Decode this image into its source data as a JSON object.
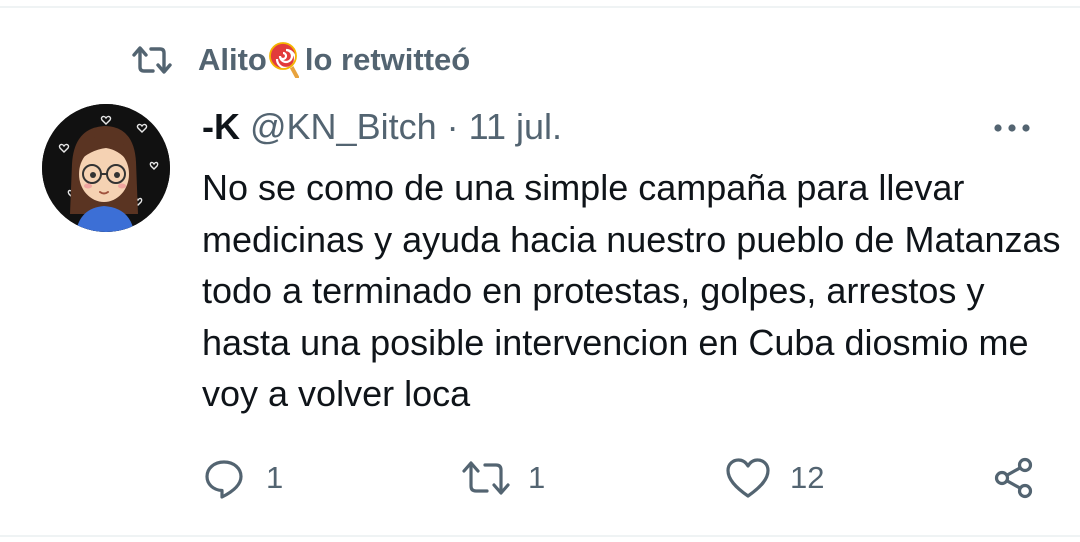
{
  "retweet": {
    "icon": "retweet-icon",
    "user": "Alito",
    "emoji": "lollipop-emoji",
    "label": "lo retwitteó"
  },
  "tweet": {
    "avatar": "avatar",
    "display_name": "-K",
    "handle": "@KN_Bitch",
    "separator": "·",
    "date": "11 jul.",
    "more_icon": "more-icon",
    "text": "No se como de una simple campaña para llevar medicinas y ayuda hacia nuestro pueblo de Matanzas todo a terminado en protestas, golpes, arrestos y hasta una posible intervencion en Cuba diosmio me voy a volver loca"
  },
  "actions": {
    "reply": {
      "icon": "reply-icon",
      "count": "1"
    },
    "retweet": {
      "icon": "retweet-icon",
      "count": "1"
    },
    "like": {
      "icon": "heart-icon",
      "count": "12"
    },
    "share": {
      "icon": "share-icon"
    }
  },
  "colors": {
    "text_primary": "#0f1419",
    "text_secondary": "#536471",
    "divider": "#eff3f4",
    "avatar_bg": "#111111"
  }
}
